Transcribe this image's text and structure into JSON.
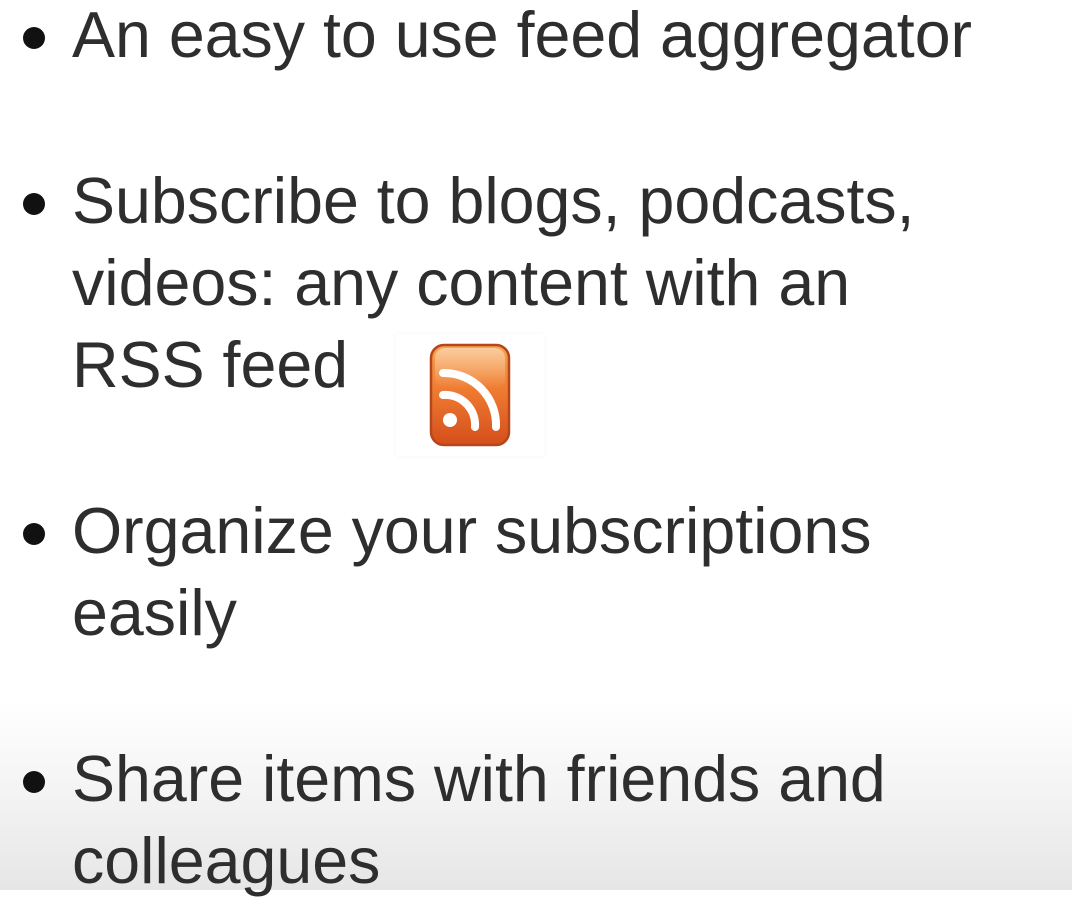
{
  "slide": {
    "bullets": [
      {
        "lines": [
          "An easy to use feed aggregator"
        ]
      },
      {
        "lines": [
          "Subscribe to blogs, podcasts,",
          "videos: any content with an",
          "RSS feed"
        ]
      },
      {
        "lines": [
          "Organize your subscriptions",
          "easily"
        ]
      },
      {
        "lines": [
          "Share items with friends and",
          "colleagues"
        ]
      }
    ],
    "rss_icon": {
      "icon": "rss-feed-icon",
      "color_top": "#f59a47",
      "color_bottom": "#d9531e",
      "glyph_color": "#ffffff"
    },
    "colors": {
      "text": "#2e2e2e",
      "bullet": "#111111",
      "background": "#ffffff"
    }
  }
}
